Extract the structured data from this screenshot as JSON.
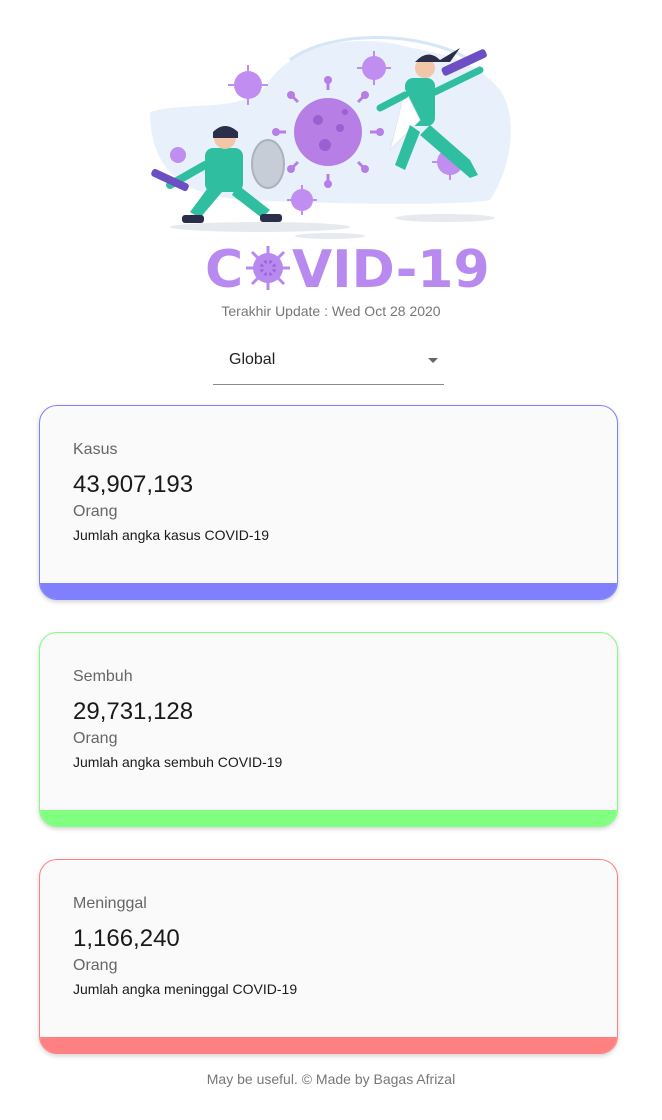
{
  "hero": {
    "logo_text_left": "C",
    "logo_text_right": "VID-19"
  },
  "last_update": "Terakhir Update : Wed Oct 28 2020",
  "region_select": {
    "value": "Global"
  },
  "cards": [
    {
      "title": "Kasus",
      "number": "43,907,193",
      "unit": "Orang",
      "description": "Jumlah angka kasus COVID-19",
      "color": "#8080ff"
    },
    {
      "title": "Sembuh",
      "number": "29,731,128",
      "unit": "Orang",
      "description": "Jumlah angka sembuh COVID-19",
      "color": "#80ff80"
    },
    {
      "title": "Meninggal",
      "number": "1,166,240",
      "unit": "Orang",
      "description": "Jumlah angka meninggal COVID-19",
      "color": "#ff8080"
    }
  ],
  "footer": "May be useful. © Made by Bagas Afrizal"
}
